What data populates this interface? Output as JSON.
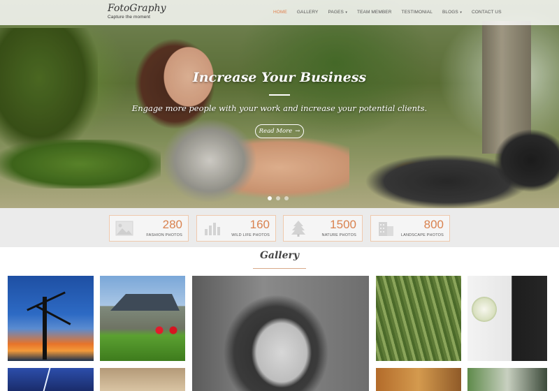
{
  "brand": {
    "title": "FotoGraphy",
    "tagline": "Capture the moment"
  },
  "nav": {
    "items": [
      {
        "label": "HOME",
        "active": true,
        "dropdown": false
      },
      {
        "label": "GALLERY",
        "active": false,
        "dropdown": false
      },
      {
        "label": "PAGES",
        "active": false,
        "dropdown": true
      },
      {
        "label": "TEAM MEMBER",
        "active": false,
        "dropdown": false
      },
      {
        "label": "TESTIMONIAL",
        "active": false,
        "dropdown": false
      },
      {
        "label": "BLOGS",
        "active": false,
        "dropdown": true
      },
      {
        "label": "CONTACT US",
        "active": false,
        "dropdown": false
      }
    ]
  },
  "hero": {
    "title": "Increase Your Business",
    "subtitle": "Engage more people with your work and increase your potential clients.",
    "button_label": "Read More",
    "button_arrow": "→",
    "slides_count": 3,
    "active_slide": 1
  },
  "stats": [
    {
      "number": "280",
      "label": "FASHION PHOTOS",
      "icon": "image-icon"
    },
    {
      "number": "160",
      "label": "WILD LIFE PHOTOS",
      "icon": "bar-chart-icon"
    },
    {
      "number": "1500",
      "label": "NATURE PHOTOS",
      "icon": "tree-icon"
    },
    {
      "number": "800",
      "label": "LANDSCAPE PHOTOS",
      "icon": "building-icon"
    }
  ],
  "gallery": {
    "title": "Gallery",
    "tiles": [
      "tree-sunset",
      "country-house",
      "girl-portrait",
      "wheat-field",
      "wedding-couple",
      "lightning-storm",
      "country-road",
      "autumn-trees",
      "couple-outdoor"
    ]
  },
  "colors": {
    "accent": "#d9824f",
    "stat_border": "#efc9ad",
    "stats_band": "#ebebeb",
    "nav_text": "#555555"
  }
}
